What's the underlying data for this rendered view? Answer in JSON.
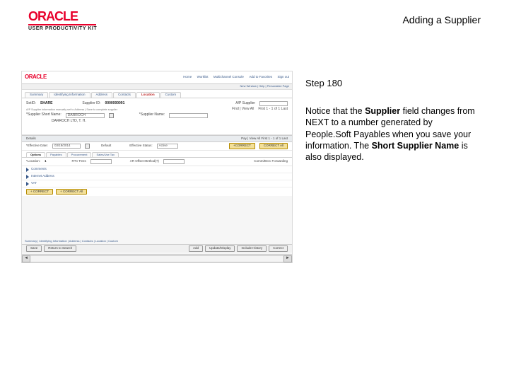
{
  "header": {
    "brand": "ORACLE",
    "kit": "USER PRODUCTIVITY KIT",
    "title": "Adding a Supplier"
  },
  "step": {
    "label": "Step 180",
    "text_prefix": "Notice that the ",
    "bold1": "Supplier",
    "text_mid1": " field changes from NEXT to a number generated by People.Soft Payables when you save your information. The ",
    "bold2": "Short Supplier Name",
    "text_suffix": " is also displayed."
  },
  "app": {
    "brand": "ORACLE",
    "topnav": {
      "n1": "Home",
      "n2": "Worklist",
      "n3": "Multichannel Console",
      "n4": "Add to Favorites",
      "n5": "Sign out"
    },
    "subbar": "New Window | Help | Personalize Page",
    "tabs": {
      "t1": "Summary",
      "t2": "Identifying Information",
      "t3": "Address",
      "t4": "Contacts",
      "t5": "Location",
      "t6": "Custom"
    },
    "info": {
      "setid_lbl": "SetID:",
      "setid_val": "SHARE",
      "supplier_id_lbl": "Supplier ID:",
      "supplier_id_val": "0000000091",
      "sname_lbl": "*Supplier Short Name:",
      "sname_val": "DARROCH",
      "name_lbl": "*Supplier Name:",
      "name_val": "DARROCH LTD, T. H.",
      "aps_lbl": "A/P Supplier",
      "aps_sub": "A/P Supplier information manually set to Address | Save to complete supplier",
      "find_view": "Find | View All",
      "first_last_top": "First 1 - 1 of 1 Last",
      "first_last_mid": "First 1 - 1 of 1 Last"
    },
    "grid": {
      "details_lbl": "Details",
      "default_lbl": "Default",
      "date_lbl": "*Effective Date:",
      "date_val": "03/19/2014",
      "status_lbl": "Effective Status:",
      "status_val": "Active",
      "pay_view": "Pay | View All",
      "correct_btn": "+CORRECT",
      "correct_all_btn": "CORRECT All",
      "name_row": "*Location:",
      "name_row_val": "1",
      "rtv_lbl": "RTV Fees",
      "rtv_val": "",
      "ar_lbl": "AR Offset Method(?)",
      "ar_val": "",
      "cc_lbl": "Comm/BCC Forwarding"
    },
    "subtabs": {
      "s1": "Options",
      "s2": "Payables",
      "s3": "Procurement",
      "s4": "Sales/Use Tax"
    },
    "sections": {
      "sec1": "Comments",
      "sec2": "Internet Address",
      "sec3": "VAT"
    },
    "footer_btns": {
      "b1": "+ CORRECT",
      "b2": "+ CORRECT All"
    },
    "crumbs": "Summary | Identifying Information | Address | Contacts | Location | Custom",
    "bottom_left": {
      "save": "Save",
      "return": "Return to Search"
    },
    "bottom_right": {
      "add": "Add",
      "dh": "Update/Display",
      "ih": "Include History",
      "ch": "Correct"
    }
  }
}
